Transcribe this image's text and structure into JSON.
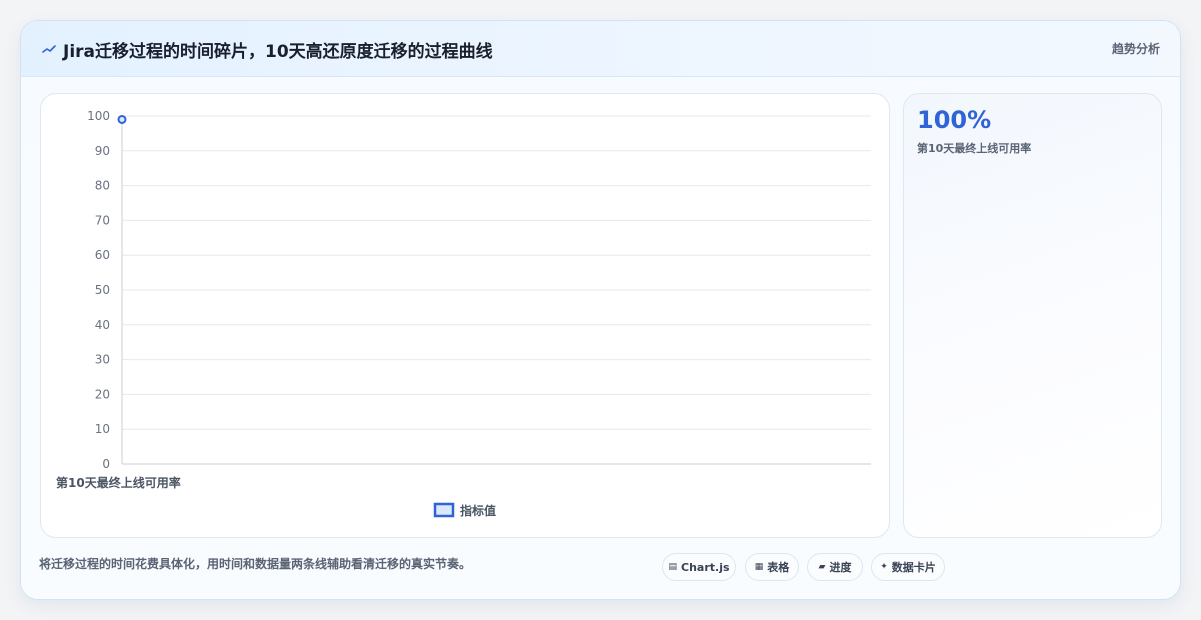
{
  "header": {
    "title": "Jira迁移过程的时间碎片，10天高还原度迁移的过程曲线",
    "tag": "趋势分析",
    "icon": "chart-line-icon"
  },
  "side": {
    "kpi_value": "100%",
    "kpi_label": "第10天最终上线可用率"
  },
  "footer": {
    "description": "将迁移过程的时间花费具体化，用时间和数据量两条线辅助看清迁移的真实节奏。",
    "chips": [
      {
        "icon": "▤",
        "label": "Chart.js",
        "icon_name": "chart-icon"
      },
      {
        "icon": "▦",
        "label": "表格",
        "icon_name": "table-icon"
      },
      {
        "icon": "▰",
        "label": "进度",
        "icon_name": "progress-icon"
      },
      {
        "icon": "✦",
        "label": "数据卡片",
        "icon_name": "sparkle-icon"
      }
    ]
  },
  "chart_data": {
    "type": "line",
    "categories": [
      "第10天最终上线可用率"
    ],
    "series": [
      {
        "name": "指标值",
        "values": [
          99
        ],
        "color": "#2f63d6"
      }
    ],
    "ylim": [
      0,
      100
    ],
    "yticks": [
      0,
      10,
      20,
      30,
      40,
      50,
      60,
      70,
      80,
      90,
      100
    ],
    "grid": true,
    "legend": "bottom"
  }
}
